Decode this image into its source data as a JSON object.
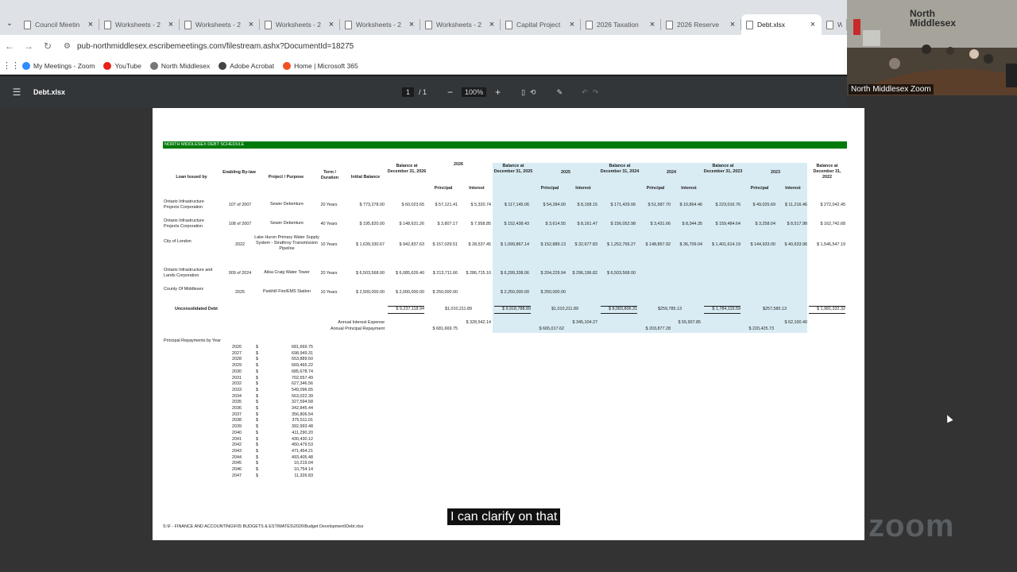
{
  "browser": {
    "tabs": [
      {
        "label": "Council Meetin",
        "active": false
      },
      {
        "label": "Worksheets - 2",
        "active": false
      },
      {
        "label": "Worksheets - 2",
        "active": false
      },
      {
        "label": "Worksheets - 2",
        "active": false
      },
      {
        "label": "Worksheets - 2",
        "active": false
      },
      {
        "label": "Worksheets - 2",
        "active": false
      },
      {
        "label": "Capital Project",
        "active": false
      },
      {
        "label": "2026 Taxation",
        "active": false
      },
      {
        "label": "2026 Reserve",
        "active": false
      },
      {
        "label": "Debt.xlsx",
        "active": true
      },
      {
        "label": "Wo",
        "active": false
      }
    ],
    "url": "pub-northmiddlesex.escribemeetings.com/filestream.ashx?DocumentId=18275",
    "bookmarks": [
      {
        "label": "My Meetings - Zoom",
        "color": "#2d8cff"
      },
      {
        "label": "YouTube",
        "color": "#e62117"
      },
      {
        "label": "North Middlesex",
        "color": "#777"
      },
      {
        "label": "Adobe Acrobat",
        "color": "#444"
      },
      {
        "label": "Home | Microsoft 365",
        "color": "#f25022"
      }
    ]
  },
  "viewer": {
    "file": "Debt.xlsx",
    "page": "1",
    "pages": "/ 1",
    "zoom": "100%"
  },
  "sheet": {
    "title": "NORTH MIDDLESEX DEBT SCHEDULE",
    "headers": {
      "loan": "Loan Issued by",
      "bylaw": "Enabling By-law",
      "project": "Project / Purpose",
      "term": "Term / Duration",
      "initial": "Initial Balance",
      "bal2026": "Balance at December 31, 2026",
      "y2026": "2026",
      "bal2025": "Balance at December 31, 2025",
      "y2025": "2025",
      "bal2024": "Balance at December 31, 2024",
      "y2024": "2024",
      "bal2023": "Balance at December 31, 2023",
      "y2023": "2023",
      "bal2022": "Balance at December 31, 2022",
      "principal": "Principal",
      "interest": "Interest"
    },
    "rows": [
      {
        "loan": "Ontario Infrastructure Projects Corporation",
        "bylaw": "107 of 2007",
        "project": "Sewer Debenture",
        "term": "20 Years",
        "initial": "$ 773,278.00",
        "b26": "$ 60,023.65",
        "p26": "$ 57,121.41",
        "i26": "$ 5,320.74",
        "b25": "$ 117,145.06",
        "p25": "$ 54,284.00",
        "i25": "$ 8,158.15",
        "b24": "$ 171,429.06",
        "p24": "$ 51,587.70",
        "i24": "$ 10,864.46",
        "b23": "$ 223,016.76",
        "p23": "$ 49,025.69",
        "i23": "$ 11,216.46",
        "b22": "$ 272,042.45"
      },
      {
        "loan": "Ontario Infrastructure Projects Corporation",
        "bylaw": "108 of 2007",
        "project": "Sewer Debenture",
        "term": "40 Years",
        "initial": "$ 195,820.00",
        "b26": "$ 148,631.26",
        "p26": "$ 3,807.17",
        "i26": "$ 7,958.85",
        "b25": "$ 152,438.43",
        "p25": "$ 3,614.55",
        "i25": "$ 8,161.47",
        "b24": "$ 156,052.98",
        "p24": "$ 3,431.66",
        "i24": "$ 8,344.35",
        "b23": "$ 159,484.64",
        "p23": "$ 3,258.04",
        "i23": "$ 8,517.98",
        "b22": "$ 162,742.68"
      },
      {
        "loan": "City of London",
        "bylaw": "2022",
        "project": "Lake Huron Primary Water Supply System - Strathroy Transmission Pipeline",
        "term": "10 Years",
        "initial": "$ 1,639,330.67",
        "b26": "$ 942,837.63",
        "p26": "$ 157,029.51",
        "i26": "$ 28,537.45",
        "b25": "$ 1,099,867.14",
        "p25": "$ 152,889.13",
        "i25": "$ 32,677.83",
        "b24": "$ 1,252,756.27",
        "p24": "$ 148,857.92",
        "i24": "$ 36,709.04",
        "b23": "$ 1,401,614.19",
        "p23": "$ 144,933.00",
        "i23": "$ 40,633.96",
        "b22": "$ 1,546,547.19"
      },
      {
        "loan": "Ontario Infrastructure and Lands Corporation",
        "bylaw": "009 of 2024",
        "project": "Ailsa Craig Water Tower",
        "term": "20 Years",
        "initial": "$ 6,503,568.00",
        "b26": "$ 6,085,626.40",
        "p26": "$ 213,711.66",
        "i26": "$ 286,715.10",
        "b25": "$ 6,299,338.06",
        "p25": "$ 204,229.94",
        "i25": "$ 296,196.82",
        "b24": "$ 6,503,568.00",
        "p24": "",
        "i24": "",
        "b23": "",
        "p23": "",
        "i23": "",
        "b22": ""
      },
      {
        "loan": "County Of Middlesex",
        "bylaw": "2025",
        "project": "Parkhill Fire/EMS Station",
        "term": "10 Years",
        "initial": "$ 2,500,000.00",
        "b26": "$ 2,000,000.00",
        "p26": "$ 250,000.00",
        "i26": "",
        "b25": "$ 2,250,000.00",
        "p25": "$ 250,000.00",
        "i25": "",
        "b24": "",
        "p24": "",
        "i24": "",
        "b23": "",
        "p23": "",
        "i23": "",
        "b22": ""
      }
    ],
    "totals": {
      "label": "Unconsolidated Debt",
      "b26": "$ 9,237,118.94",
      "pi26": "$1,010,211.89",
      "b25": "$ 9,918,788.89",
      "pi25": "$1,010,211.89",
      "b24": "$ 8,083,806.31",
      "pi24": "$259,785.13",
      "b23": "$ 1,784,115.59",
      "pi23": "$257,585.13",
      "b22": "$ 1,981,332.32"
    },
    "annual": {
      "interest_label": "Annual Interest Expense",
      "principal_label": "Annual Principal Repayment",
      "i26": "$ 328,542.14",
      "p26": "$ 681,669.75",
      "i25": "$ 345,104.27",
      "p25": "$ 665,017.62",
      "i24": "$ 55,907.85",
      "p24": "$ 203,877.28",
      "i23": "$ 62,100.40",
      "p23": "$ 220,425.73"
    },
    "principal_title": "Principal Repayments by Year",
    "repayments": [
      {
        "year": "2026",
        "amount": "681,669.75"
      },
      {
        "year": "2027",
        "amount": "698,949.31"
      },
      {
        "year": "2028",
        "amount": "653,889.60"
      },
      {
        "year": "2029",
        "amount": "669,465.22"
      },
      {
        "year": "2030",
        "amount": "685,678.74"
      },
      {
        "year": "2031",
        "amount": "702,557.49"
      },
      {
        "year": "2032",
        "amount": "627,346.56"
      },
      {
        "year": "2033",
        "amount": "549,096.65"
      },
      {
        "year": "2034",
        "amount": "563,022.39"
      },
      {
        "year": "2035",
        "amount": "327,594.58"
      },
      {
        "year": "2036",
        "amount": "342,845.44"
      },
      {
        "year": "2037",
        "amount": "356,806.54"
      },
      {
        "year": "2038",
        "amount": "375,511.01"
      },
      {
        "year": "2039",
        "amount": "392,993.48"
      },
      {
        "year": "2040",
        "amount": "411,290.20"
      },
      {
        "year": "2041",
        "amount": "430,430.12"
      },
      {
        "year": "2042",
        "amount": "450,479.53"
      },
      {
        "year": "2043",
        "amount": "471,454.21"
      },
      {
        "year": "2044",
        "amount": "493,405.48"
      },
      {
        "year": "2045",
        "amount": "10,219.04"
      },
      {
        "year": "2046",
        "amount": "10,754.14"
      },
      {
        "year": "2047",
        "amount": "11,326.83"
      }
    ],
    "footer": "S:\\F - FINANCE AND ACCOUNTING\\F05 BUDGETS & ESTIMATES\\2026\\Budget Development\\Debt.xlsx"
  },
  "zoom": {
    "participant": "North Middlesex Zoom",
    "logo_line1": "North",
    "logo_line2": "Middlesex",
    "caption": "I can clarify on that",
    "brand": "zoom"
  }
}
